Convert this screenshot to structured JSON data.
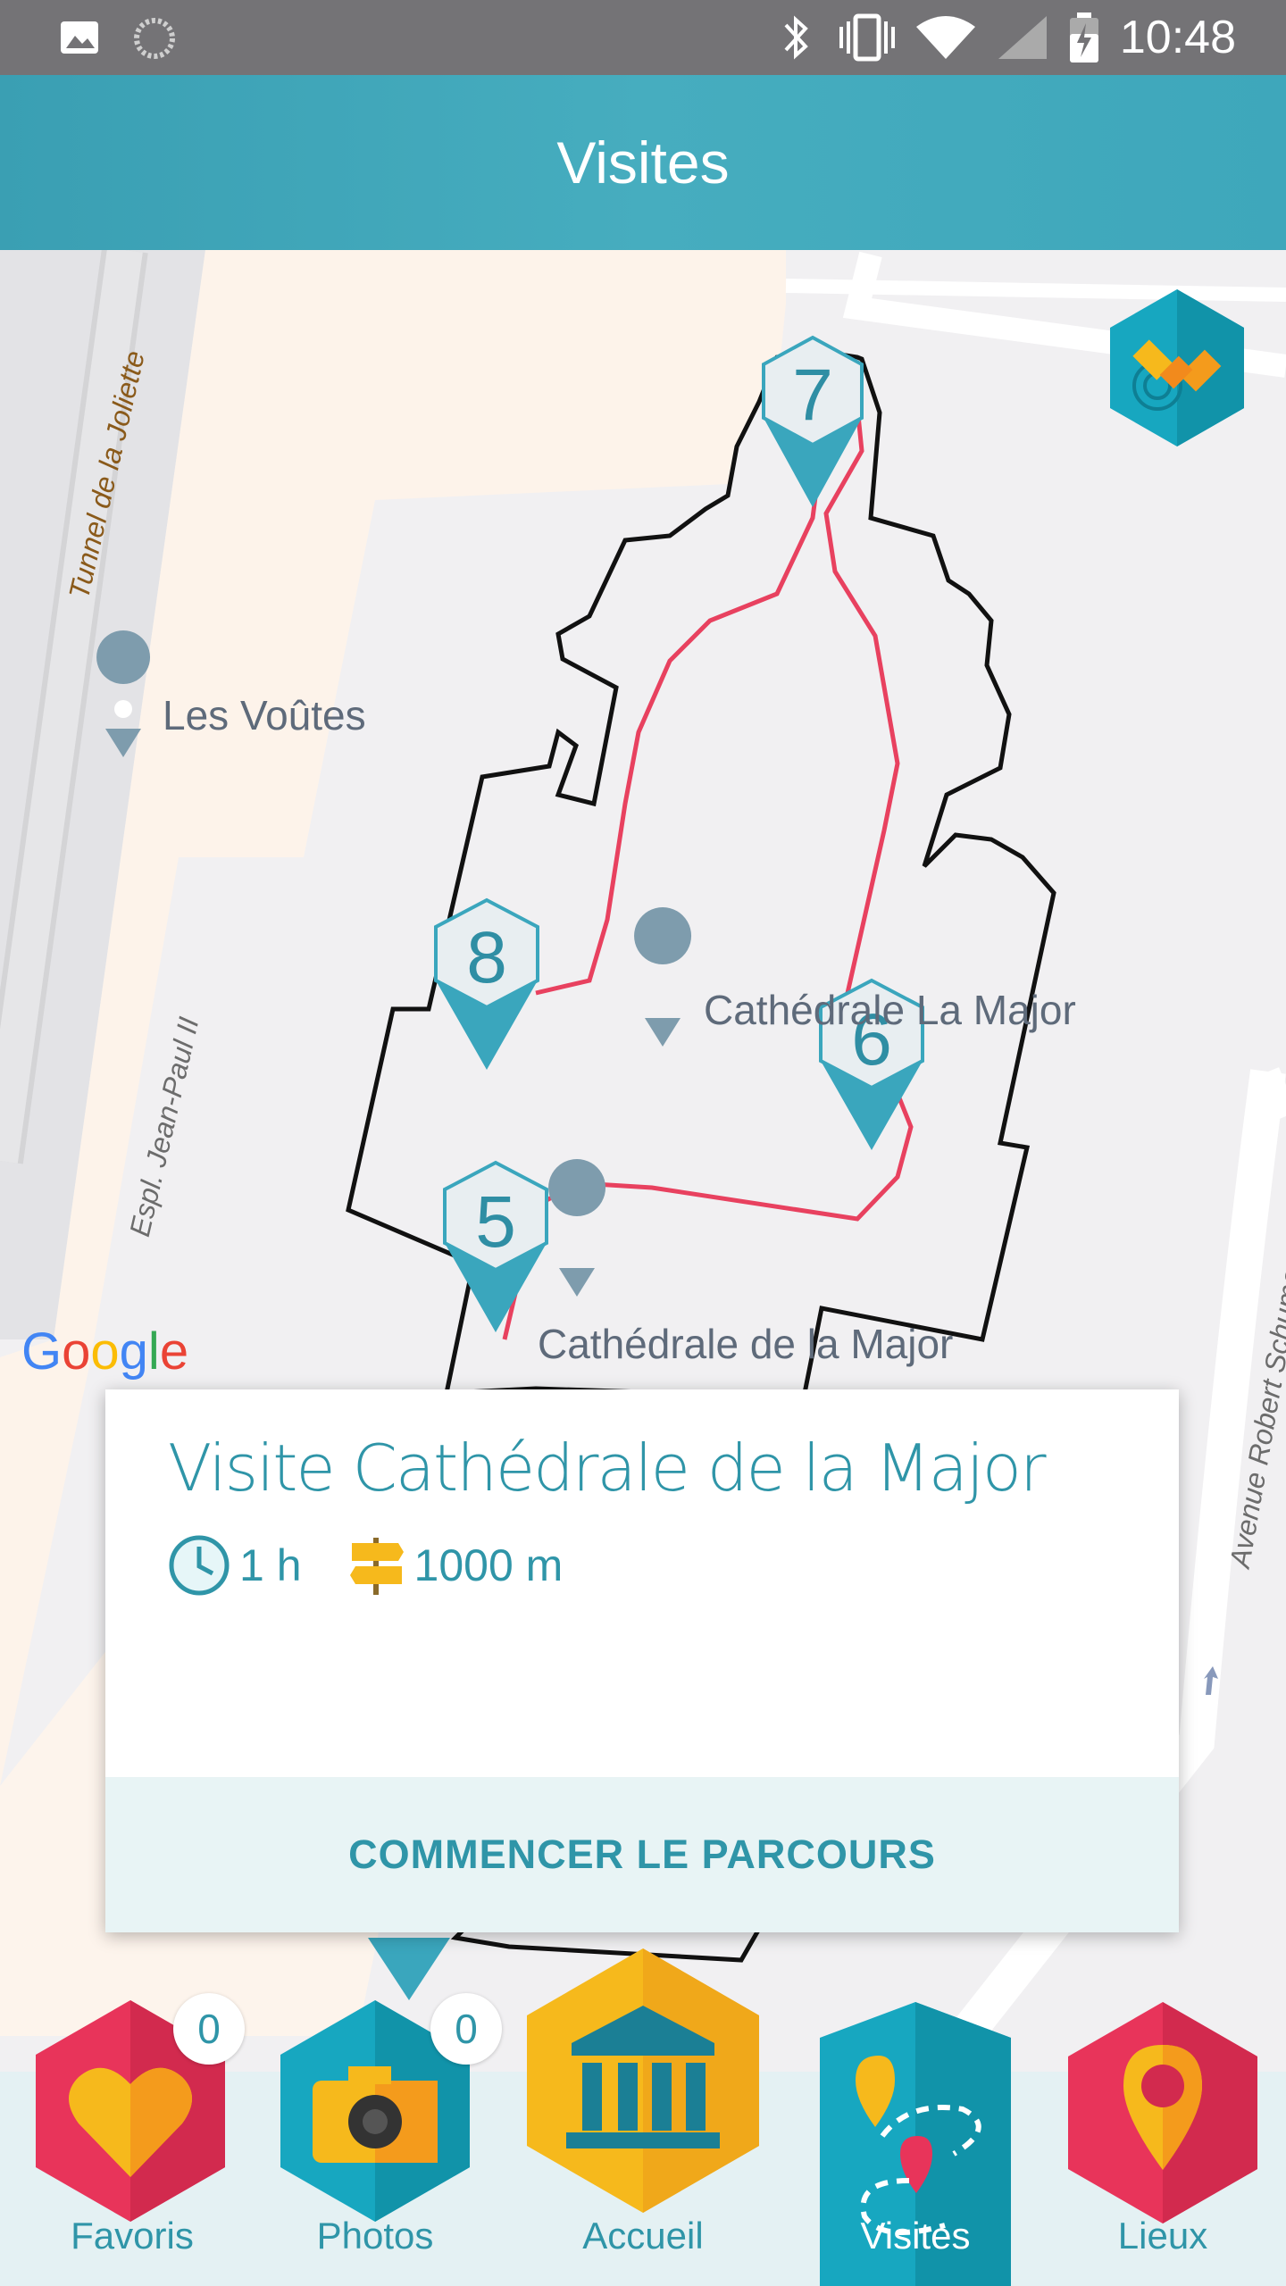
{
  "status_bar": {
    "time": "10:48",
    "icons": [
      "image-icon",
      "loading-icon",
      "bluetooth-icon",
      "vibrate-icon",
      "wifi-icon",
      "signal-icon",
      "battery-icon"
    ]
  },
  "header": {
    "title": "Visites"
  },
  "map": {
    "labels": {
      "les_voutes": "Les Voûtes",
      "cathedrale_top": "Cathédrale La Major",
      "cathedrale_bottom": "Cathédrale de la Major",
      "tunnel": "Tunnel de la Joliette",
      "espl": "Espl. Jean-Paul II",
      "avenue": "Avenue Robert Schuman"
    },
    "markers": [
      "7",
      "8",
      "6",
      "5"
    ],
    "google": "Google",
    "colors": {
      "route": "#e8415f",
      "outline": "#111111",
      "marker": "#3aa6bd"
    }
  },
  "card": {
    "title": "Visite Cathédrale de la Major",
    "duration": "1 h",
    "distance": "1000 m",
    "action": "COMMENCER LE PARCOURS"
  },
  "bottom_nav": {
    "items": [
      {
        "label": "Favoris",
        "icon": "heart-icon",
        "badge": "0"
      },
      {
        "label": "Photos",
        "icon": "camera-icon",
        "badge": "0"
      },
      {
        "label": "Accueil",
        "icon": "museum-icon"
      },
      {
        "label": "Visites",
        "icon": "route-map-icon",
        "active": true
      },
      {
        "label": "Lieux",
        "icon": "location-pin-icon"
      }
    ]
  },
  "colors": {
    "accent": "#2f95a8",
    "header": "#45abbe",
    "favoris": "#e8345a",
    "accueil": "#f6b91c"
  }
}
